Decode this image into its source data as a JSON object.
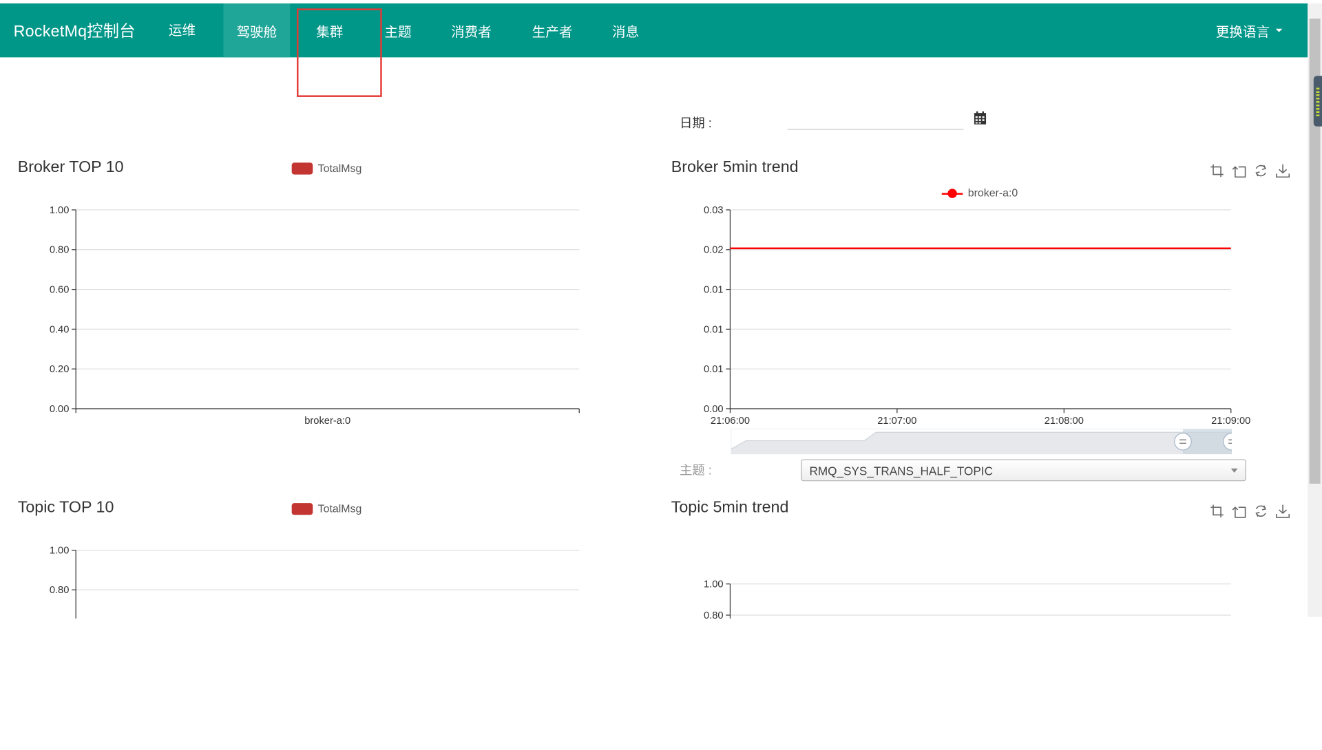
{
  "navbar": {
    "brand": "RocketMq控制台",
    "items": [
      {
        "label": "运维",
        "active": false
      },
      {
        "label": "驾驶舱",
        "active": true
      },
      {
        "label": "集群",
        "active": false
      },
      {
        "label": "主题",
        "active": false
      },
      {
        "label": "消费者",
        "active": false
      },
      {
        "label": "生产者",
        "active": false
      },
      {
        "label": "消息",
        "active": false
      }
    ],
    "language_label": "更换语言",
    "background_color": "#009688"
  },
  "filters": {
    "date_label": "日期 :",
    "date_value": "",
    "topic_label": "主题 :",
    "topic_value": "RMQ_SYS_TRANS_HALF_TOPIC"
  },
  "icons": {
    "date": "calendar-icon",
    "toolbox": [
      "zoom-icon",
      "zoom-reset-icon",
      "restore-icon",
      "save-image-icon"
    ]
  },
  "chart_data": [
    {
      "id": "broker-top10",
      "type": "bar",
      "title": "Broker TOP 10",
      "legend": [
        "TotalMsg"
      ],
      "legend_position": "top",
      "categories": [
        "broker-a:0"
      ],
      "series": [
        {
          "name": "TotalMsg",
          "values": [
            0
          ]
        }
      ],
      "y_ticks": [
        "0.00",
        "0.20",
        "0.40",
        "0.60",
        "0.80",
        "1.00"
      ],
      "ylim": [
        0,
        1
      ],
      "grid": true,
      "color": "#c23531"
    },
    {
      "id": "broker-5min-trend",
      "type": "line",
      "title": "Broker 5min trend",
      "legend": [
        "broker-a:0"
      ],
      "legend_position": "top",
      "x": [
        "21:06:00",
        "21:09:00"
      ],
      "x_ticks": [
        "21:06:00",
        "21:07:00",
        "21:08:00",
        "21:09:00"
      ],
      "series": [
        {
          "name": "broker-a:0",
          "values": [
            0.0242,
            0.0242
          ]
        }
      ],
      "y_ticks": [
        "0.00",
        "0.01",
        "0.01",
        "0.01",
        "0.02",
        "0.03"
      ],
      "ylim": [
        0,
        0.03
      ],
      "grid": true,
      "color": "#ff0000",
      "data_zoom": true
    },
    {
      "id": "topic-top10",
      "type": "bar",
      "title": "Topic TOP 10",
      "legend": [
        "TotalMsg"
      ],
      "legend_position": "top",
      "categories": [],
      "series": [
        {
          "name": "TotalMsg",
          "values": []
        }
      ],
      "y_ticks": [
        "0.80",
        "1.00"
      ],
      "ylim": [
        0,
        1
      ],
      "grid": true,
      "color": "#c23531"
    },
    {
      "id": "topic-5min-trend",
      "type": "line",
      "title": "Topic 5min trend",
      "legend": [],
      "series": [],
      "y_ticks": [
        "0.80",
        "1.00"
      ],
      "ylim": [
        0,
        1
      ],
      "grid": true
    }
  ]
}
